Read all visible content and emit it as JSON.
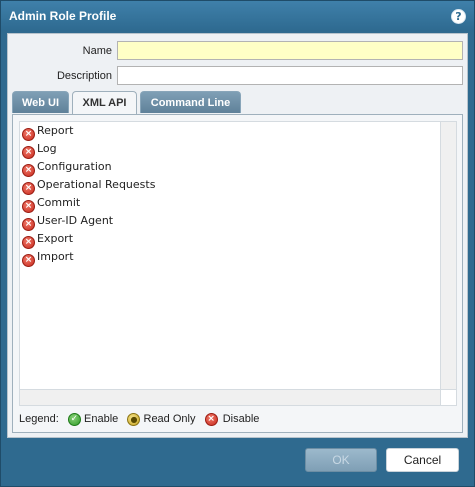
{
  "dialog": {
    "title": "Admin Role Profile",
    "help_icon": "help-icon"
  },
  "form": {
    "name_label": "Name",
    "name_value": "",
    "description_label": "Description",
    "description_value": ""
  },
  "tabs": [
    {
      "label": "Web UI",
      "active": false
    },
    {
      "label": "XML API",
      "active": true
    },
    {
      "label": "Command Line",
      "active": false
    }
  ],
  "permissions": [
    {
      "label": "Report",
      "state": "disable"
    },
    {
      "label": "Log",
      "state": "disable"
    },
    {
      "label": "Configuration",
      "state": "disable"
    },
    {
      "label": "Operational Requests",
      "state": "disable"
    },
    {
      "label": "Commit",
      "state": "disable"
    },
    {
      "label": "User-ID Agent",
      "state": "disable"
    },
    {
      "label": "Export",
      "state": "disable"
    },
    {
      "label": "Import",
      "state": "disable"
    }
  ],
  "legend": {
    "label": "Legend:",
    "enable": "Enable",
    "read_only": "Read Only",
    "disable": "Disable"
  },
  "buttons": {
    "ok": "OK",
    "cancel": "Cancel"
  },
  "colors": {
    "dialog_frame": "#2f6a8f",
    "name_field_bg": "#ffffc6",
    "disable_icon": "#c8281c",
    "enable_icon": "#2e9a26",
    "read_only_icon": "#c7a21c"
  }
}
